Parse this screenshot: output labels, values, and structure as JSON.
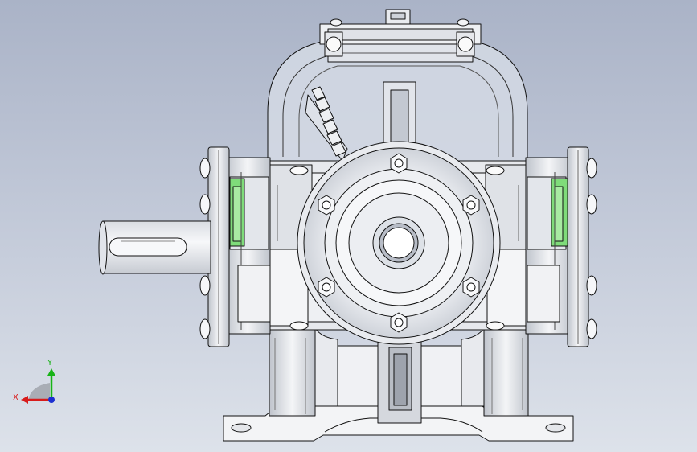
{
  "viewport": {
    "background_top": "#aab3c7",
    "background_bottom": "#dde2ea",
    "part_fill": "#f3f4f6",
    "shade_fill": "#c8ccd4",
    "glass_fill": "#cfd5e2",
    "edge_color": "#111111",
    "green_seal": "#7fdc7a"
  },
  "triad": {
    "x_label": "X",
    "y_label": "Y",
    "x_color": "#d81b1b",
    "y_color": "#17b317",
    "z_color": "#1c2fd1",
    "origin_icon": "coordinate-triad-icon"
  }
}
